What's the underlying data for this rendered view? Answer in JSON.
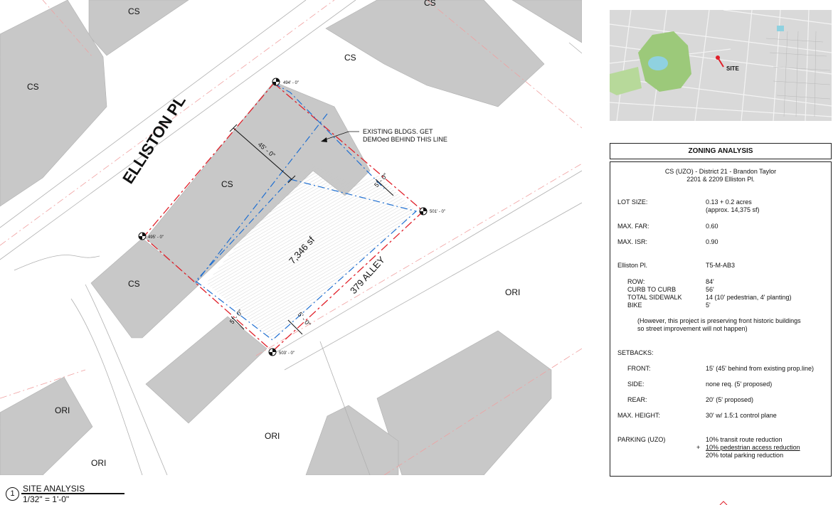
{
  "site_plan": {
    "street_name": "ELLISTON PL",
    "alley_name": "379 ALLEY",
    "area_label": "7,346 sf",
    "zone_labels": {
      "cs_top_left": "CS",
      "cs_top_right": "CS",
      "cs_mid_right": "CS",
      "cs_left": "CS",
      "cs_site": "CS",
      "cs_lower": "CS",
      "ori_right": "ORI",
      "ori_bottom_mid": "ORI",
      "ori_bottom_left": "ORI",
      "ori_bottom_far_left": "ORI"
    },
    "elevations": {
      "top": "494' - 0\"",
      "left": "495' - 0\"",
      "right": "501' - 0\"",
      "bottom": "503' - 0\""
    },
    "dimensions": {
      "front_setback": "45' - 0\"",
      "side_top": "5' - 0\"",
      "side_bottom": "5' - 0\"",
      "rear": "5' - 0\""
    },
    "demo_note": {
      "line1": "EXISTING BLDGS. GET",
      "line2": "DEMOed BEHIND THIS LINE"
    },
    "colors": {
      "property_line": "#e0202a",
      "setback_line": "#1f6fd1",
      "building_fill": "#c8c8c8",
      "right_of_way": "#f0a0a0"
    }
  },
  "vicinity_map": {
    "site_label": "SITE",
    "colors": {
      "park": "#9cc97a",
      "water": "#8fd1e0",
      "base": "#d9d9d9"
    }
  },
  "zoning_analysis": {
    "heading": "ZONING ANALYSIS",
    "zone_line": "CS (UZO) - District 21 - Brandon Taylor",
    "address_line": "2201 & 2209 Elliston Pl.",
    "lot_size_label": "LOT SIZE:",
    "lot_size_value": "0.13 + 0.2 acres",
    "lot_size_value2": "(approx. 14,375 sf)",
    "far_label": "MAX. FAR:",
    "far_value": "0.60",
    "isr_label": "MAX. ISR:",
    "isr_value": "0.90",
    "street_label": "Elliston Pl.",
    "street_value": "T5-M-AB3",
    "row_label": "ROW:",
    "row_value": "84'",
    "ctc_label": "CURB TO CURB",
    "ctc_value": "56'",
    "sidewalk_label": "TOTAL SIDEWALK",
    "sidewalk_value": "14 (10' pedestrian, 4' planting)",
    "bike_label": "BIKE",
    "bike_value": "5'",
    "note_line1": "(However, this project is preserving front historic buildings",
    "note_line2": "so street improvement will not happen)",
    "setbacks_label": "SETBACKS:",
    "front_label": "FRONT:",
    "front_value": "15' (45' behind from existing prop.line)",
    "side_label": "SIDE:",
    "side_value": "none req. (5' proposed)",
    "rear_label": "REAR:",
    "rear_value": "20' (5' proposed)",
    "height_label": "MAX. HEIGHT:",
    "height_value": "30' w/ 1.5:1 control plane",
    "parking_label": "PARKING (UZO)",
    "parking_line1": "10% transit route reduction",
    "parking_plus": "+",
    "parking_line2": "10% pedestrian access reduction",
    "parking_line3": "20% total parking reduction"
  },
  "title_block": {
    "number": "1",
    "title": "SITE ANALYSIS",
    "scale": "1/32\" = 1'-0\""
  }
}
